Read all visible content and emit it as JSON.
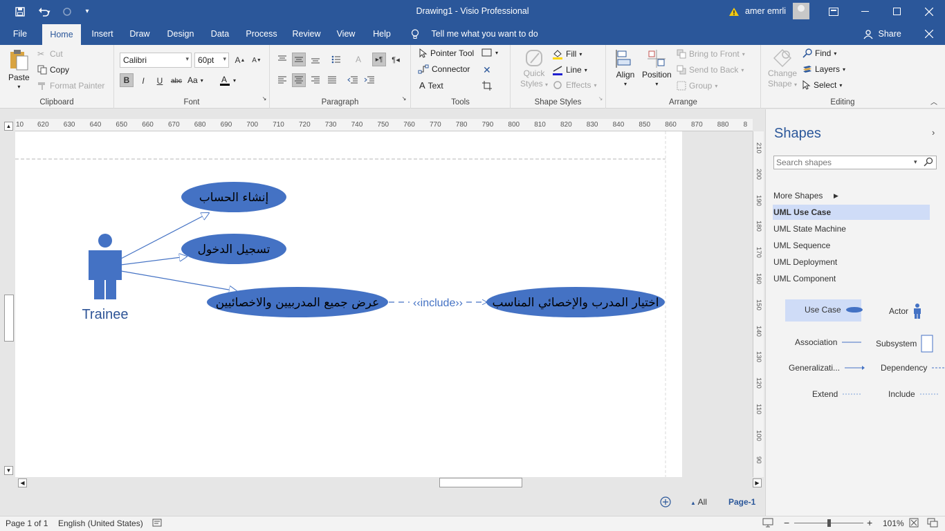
{
  "titlebar": {
    "title": "Drawing1  -  Visio Professional",
    "user": "amer emrli",
    "icons": [
      "save-icon",
      "undo-icon",
      "redo-icon",
      "customize-icon",
      "warning-icon",
      "ribbon-display-icon",
      "minimize-icon",
      "maximize-icon",
      "close-icon"
    ]
  },
  "tabs": [
    {
      "label": "File"
    },
    {
      "label": "Home"
    },
    {
      "label": "Insert"
    },
    {
      "label": "Draw"
    },
    {
      "label": "Design"
    },
    {
      "label": "Data"
    },
    {
      "label": "Process"
    },
    {
      "label": "Review"
    },
    {
      "label": "View"
    },
    {
      "label": "Help"
    }
  ],
  "tellme": "Tell me what you want to do",
  "share": "Share",
  "ribbon": {
    "clipboard": {
      "name": "Clipboard",
      "paste": "Paste",
      "cut": "Cut",
      "copy": "Copy",
      "format_painter": "Format Painter"
    },
    "font": {
      "name": "Font",
      "family": "Calibri",
      "size": "60pt",
      "aa": "Aa"
    },
    "paragraph": {
      "name": "Paragraph"
    },
    "tools": {
      "name": "Tools",
      "pointer": "Pointer Tool",
      "connector": "Connector",
      "text": "Text"
    },
    "shape_styles": {
      "name": "Shape Styles",
      "quick": "Quick",
      "styles": "Styles",
      "fill": "Fill",
      "line": "Line",
      "effects": "Effects"
    },
    "arrange": {
      "name": "Arrange",
      "align": "Align",
      "position": "Position",
      "bring_front": "Bring to Front",
      "send_back": "Send to Back",
      "group": "Group"
    },
    "editing": {
      "name": "Editing",
      "change": "Change",
      "shape": "Shape",
      "find": "Find",
      "layers": "Layers",
      "select": "Select"
    }
  },
  "ruler": {
    "h": [
      "10",
      "620",
      "630",
      "640",
      "650",
      "660",
      "670",
      "680",
      "690",
      "700",
      "710",
      "720",
      "730",
      "740",
      "750",
      "760",
      "770",
      "780",
      "790",
      "800",
      "810",
      "820",
      "830",
      "840",
      "850",
      "860",
      "870",
      "880",
      "8"
    ],
    "v": [
      "210",
      "200",
      "190",
      "180",
      "170",
      "160",
      "150",
      "140",
      "130",
      "120",
      "110",
      "100",
      "90"
    ]
  },
  "diagram": {
    "actor": "Trainee",
    "uc1": "إنشاء الحساب",
    "uc2": "تسجيل الدخول",
    "uc3": "عرض جميع المدربيين والاخصائيين",
    "uc4": "اختيار المدرب والإخصائي المناسب",
    "include": "‹‹include››",
    "color": "#4472c4"
  },
  "shapes": {
    "title": "Shapes",
    "search_placeholder": "Search shapes",
    "more": "More Shapes",
    "stencils": [
      "UML Use Case",
      "UML State Machine",
      "UML Sequence",
      "UML Deployment",
      "UML Component"
    ],
    "masters": {
      "use_case": "Use Case",
      "actor": "Actor",
      "association": "Association",
      "subsystem": "Subsystem",
      "generalization": "Generalizati...",
      "dependency": "Dependency",
      "extend": "Extend",
      "include": "Include"
    }
  },
  "pages": {
    "all": "All",
    "page1": "Page-1"
  },
  "status": {
    "page": "Page 1 of 1",
    "language": "English (United States)",
    "zoom": "101%"
  }
}
